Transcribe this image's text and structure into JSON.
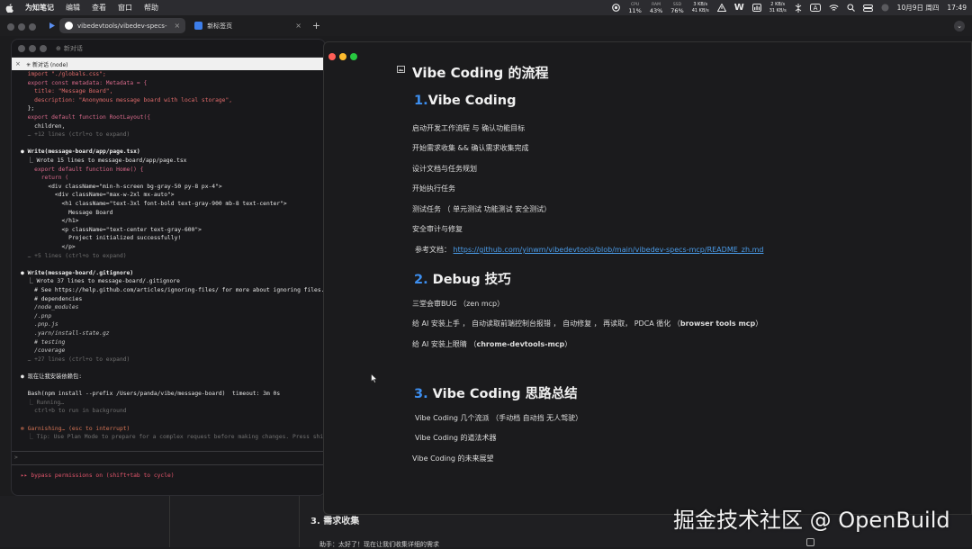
{
  "menubar": {
    "app": "为知笔记",
    "items": [
      "编辑",
      "查看",
      "窗口",
      "帮助"
    ],
    "stats": {
      "cpu_label": "CPU",
      "cpu": "11%",
      "ram_label": "RAM",
      "ram": "43%",
      "ssd_label": "SSD",
      "ssd": "76%",
      "net_up": "3 KB/s",
      "net_down": "41 KB/s",
      "net2_up": "2 KB/s",
      "net2_down": "31 KB/s"
    },
    "date": "10月9日 周四",
    "time": "17:49",
    "icons": [
      "apple-icon",
      "record-icon",
      "warning-icon",
      "w-app-icon",
      "dashboard-icon",
      "cast-icon",
      "a-input-icon",
      "wifi-icon",
      "search-icon",
      "control-center-icon",
      "user-icon"
    ]
  },
  "tabs": [
    {
      "label": "vibedevtools/vibedev-specs-",
      "icon": "github-icon"
    },
    {
      "label": "新标签页",
      "icon": "newtab-icon"
    }
  ],
  "terminal": {
    "title": "新对话",
    "subtitle": "新对话 (node)",
    "lines": [
      {
        "t": "  import \"./globals.css\";",
        "c": "c-str"
      },
      {
        "t": "  export const metadata: Metadata = {",
        "c": "c-key"
      },
      {
        "t": "    title: \"Message Board\",",
        "c": "c-str"
      },
      {
        "t": "    description: \"Anonymous message board with local storage\",",
        "c": "c-str"
      },
      {
        "t": "  };",
        "c": "c-white"
      },
      {
        "t": "  export default function RootLayout({",
        "c": "c-key"
      },
      {
        "t": "    children,",
        "c": "c-white"
      },
      {
        "t": "  … +12 lines (ctrl+o to expand)",
        "c": "c-dim"
      },
      {
        "t": "",
        "c": "c-dim"
      },
      {
        "t": "● Write(message-board/app/page.tsx)",
        "c": "c-bold"
      },
      {
        "t": "  ⎿ Wrote 15 lines to message-board/app/page.tsx",
        "c": "c-white"
      },
      {
        "t": "    export default function Home() {",
        "c": "c-key"
      },
      {
        "t": "      return (",
        "c": "c-key"
      },
      {
        "t": "        <div className=\"min-h-screen bg-gray-50 py-8 px-4\">",
        "c": "c-white"
      },
      {
        "t": "          <div className=\"max-w-2xl mx-auto\">",
        "c": "c-white"
      },
      {
        "t": "            <h1 className=\"text-3xl font-bold text-gray-900 mb-8 text-center\">",
        "c": "c-white"
      },
      {
        "t": "              Message Board",
        "c": "c-white"
      },
      {
        "t": "            </h1>",
        "c": "c-white"
      },
      {
        "t": "            <p className=\"text-center text-gray-600\">",
        "c": "c-white"
      },
      {
        "t": "              Project initialized successfully!",
        "c": "c-white"
      },
      {
        "t": "            </p>",
        "c": "c-white"
      },
      {
        "t": "  … +5 lines (ctrl+o to expand)",
        "c": "c-dim"
      },
      {
        "t": "",
        "c": "c-dim"
      },
      {
        "t": "● Write(message-board/.gitignore)",
        "c": "c-bold"
      },
      {
        "t": "  ⎿ Wrote 37 lines to message-board/.gitignore",
        "c": "c-white"
      },
      {
        "t": "    # See https://help.github.com/articles/ignoring-files/ for more about ignoring files.",
        "c": "c-white"
      },
      {
        "t": "    # dependencies",
        "c": "c-white"
      },
      {
        "t": "    /node_modules",
        "c": "c-it"
      },
      {
        "t": "    /.pnp",
        "c": "c-it"
      },
      {
        "t": "    .pnp.js",
        "c": "c-it"
      },
      {
        "t": "    .yarn/install-state.gz",
        "c": "c-it"
      },
      {
        "t": "    # testing",
        "c": "c-it"
      },
      {
        "t": "    /coverage",
        "c": "c-it"
      },
      {
        "t": "  … +27 lines (ctrl+o to expand)",
        "c": "c-dim"
      },
      {
        "t": "",
        "c": "c-dim"
      },
      {
        "t": "● 现在让我安装依赖包:",
        "c": "c-white"
      },
      {
        "t": "",
        "c": "c-dim"
      },
      {
        "t": "  Bash(npm install --prefix /Users/panda/vibe/message-board)  timeout: 3m 0s",
        "c": "c-white"
      },
      {
        "t": "  ⎿ Running…",
        "c": "c-dim"
      },
      {
        "t": "    ctrl+b to run in background",
        "c": "c-dim"
      },
      {
        "t": "",
        "c": "c-dim"
      },
      {
        "t": "✻ Garnishing… (esc to interrupt)",
        "c": "c-orange"
      },
      {
        "t": "  ⎿ Tip: Use Plan Mode to prepare for a complex request before making changes. Press shift+tab twice",
        "c": "c-dim"
      }
    ],
    "prompt": ">",
    "footer": "▸▸ bypass permissions on (shift+tab to cycle)"
  },
  "doc": {
    "title": "Vibe Coding 的流程",
    "s1_num": "1.",
    "s1_title": "Vibe Coding",
    "s1_items": [
      "启动开发工作流程 与 确认功能目标",
      "开始需求收集 && 确认需求收集完成",
      "设计文档与任务规划",
      "开始执行任务",
      "测试任务 （ 单元测试 功能测试  安全测试）",
      "安全审计与修复"
    ],
    "ref_label": "参考文档：",
    "ref_link": "https://github.com/yinwm/vibedevtools/blob/main/vibedev-specs-mcp/README_zh.md",
    "s2_num": "2.",
    "s2_title": "Debug 技巧",
    "s2_items": [
      {
        "pre": "三堂会审BUG  （zen mcp）",
        "bold": "",
        "post": ""
      },
      {
        "pre": "给 AI 安装上手 ，  自动读取前端控制台报错 ，  自动修复 ， 再读取， PDCA 循化  （",
        "bold": "browser tools mcp",
        "post": "）"
      },
      {
        "pre": "给 AI 安装上眼睛  （",
        "bold": "chrome-devtools-mcp",
        "post": "）"
      }
    ],
    "s3_num": "3.",
    "s3_title": "Vibe Coding 思路总结",
    "s3_items": [
      "Vibe Coding 几个流派  （手动档  自动挡 无人驾驶）",
      "Vibe Coding 的道法术器",
      "Vibe Coding 的未来展望"
    ]
  },
  "bottom": {
    "heading": "3. 需求收集",
    "message": "助手：太好了！现在让我们收集详细的需求"
  },
  "watermark": "掘金技术社区 @ OpenBuild",
  "colors": {
    "accent": "#3d8ff0",
    "link": "#4a9be8",
    "close": "#ff5f57",
    "min": "#febc2e",
    "max": "#28c840"
  }
}
